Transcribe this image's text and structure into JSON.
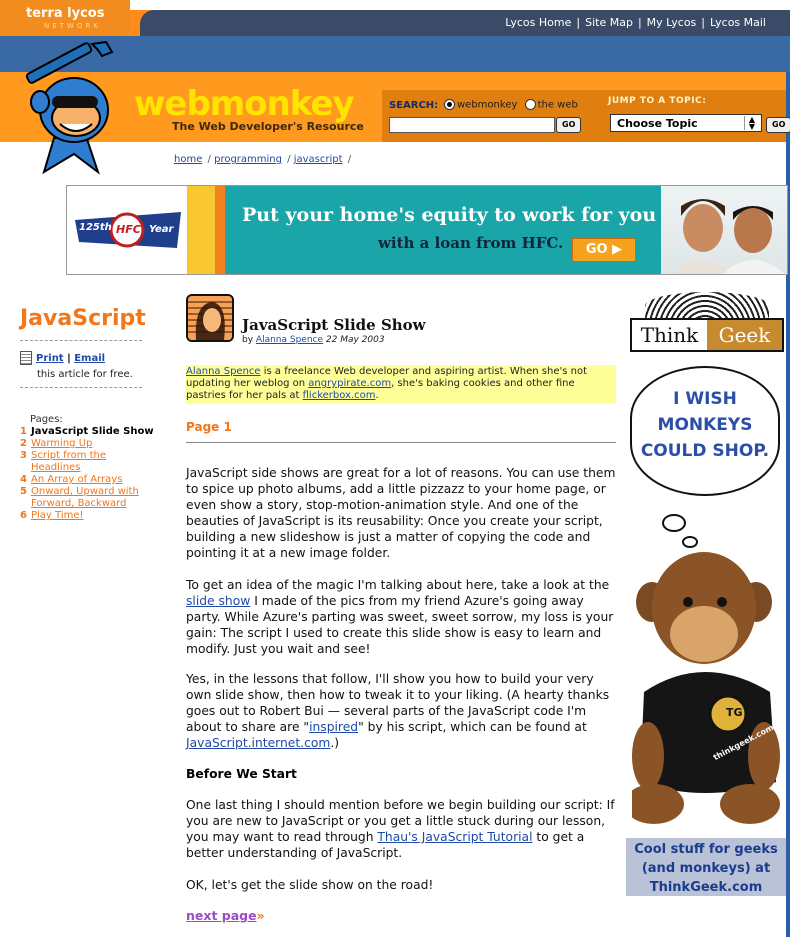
{
  "lycos_bar": {
    "brand": "terra lycos",
    "network": "NETWORK",
    "links": [
      "Lycos Home",
      "Site Map",
      "My Lycos",
      "Lycos Mail"
    ]
  },
  "header": {
    "title": "webmonkey",
    "subtitle": "The Web Developer's Resource",
    "search_label": "SEARCH:",
    "search_options": [
      "webmonkey",
      "the web"
    ],
    "search_selected": "webmonkey",
    "search_value": "",
    "go_label": "GO",
    "topic_label": "JUMP TO A TOPIC:",
    "topic_selected": "Choose Topic"
  },
  "breadcrumb": [
    "home",
    "programming",
    "javascript"
  ],
  "ad_banner": {
    "headline": "Put your home's equity to work for you",
    "subline": "with a loan from HFC.",
    "button": "GO",
    "badge_left": "125th",
    "badge_logo": "HFC",
    "badge_right": "Year"
  },
  "sidebar": {
    "section_title": "JavaScript",
    "print_label": "Print",
    "email_label": "Email",
    "free_text": "this article for free.",
    "pages_label": "Pages:",
    "pages": [
      {
        "num": "1",
        "label": "JavaScript Slide Show",
        "current": true
      },
      {
        "num": "2",
        "label": "Warming Up",
        "current": false
      },
      {
        "num": "3",
        "label": "Script from the Headlines",
        "current": false
      },
      {
        "num": "4",
        "label": "An Array of Arrays",
        "current": false
      },
      {
        "num": "5",
        "label": "Onward, Upward with Forward, Backward",
        "current": false
      },
      {
        "num": "6",
        "label": "Play Time!",
        "current": false
      }
    ]
  },
  "article": {
    "title": "JavaScript Slide Show",
    "by": "by",
    "author": "Alanna Spence",
    "date": "22 May 2003",
    "bio": {
      "author_link": "Alanna Spence",
      "text1": " is a freelance Web developer and aspiring artist. When she's not updating her weblog on ",
      "link1": "angrypirate.com",
      "text2": ", she's baking cookies and other fine pastries for her pals at ",
      "link2": "flickerbox.com",
      "text3": "."
    },
    "page_heading": "Page 1",
    "p1": "JavaScript side shows are great for a lot of reasons. You can use them to spice up photo albums, add a little pizzazz to your home page, or even show a story, stop-motion-animation style. And one of the beauties of JavaScript is its reusability: Once you create your script, building a new slideshow is just a matter of copying the code and pointing it at a new image folder.",
    "p2": {
      "a": "To get an idea of the magic I'm talking about here, take a look at the ",
      "link": "slide show",
      "b": " I made of the pics from my friend Azure's going away party. While Azure's parting was sweet, sweet sorrow, my loss is your gain: The script I used to create this slide show is easy to learn and modify. Just you wait and see!"
    },
    "p3": {
      "a": "Yes, in the lessons that follow, I'll show you how to build your very own slide show, then how to tweak it to your liking. (A hearty thanks goes out to Robert Bui — several parts of the JavaScript code I'm about to share are \"",
      "link1": "inspired",
      "b": "\" by his script, which can be found at ",
      "link2": "JavaScript.internet.com",
      "c": ".)"
    },
    "subheading": "Before We Start",
    "p4": {
      "a": "One last thing I should mention before we begin building our script: If you are new to JavaScript or you get a little stuck during our lesson, you may want to read through ",
      "link": "Thau's JavaScript Tutorial",
      "b": " to get a better understanding of JavaScript."
    },
    "p5": "OK, let's get the slide show on the road!",
    "next_label": "next page",
    "next_arrow": "»"
  },
  "right_ad": {
    "brand_left": "Think",
    "brand_right": "Geek",
    "bubble": "I WISH MONKEYS COULD SHOP.",
    "shirt_logo": "TG",
    "shirt_text": "thinkgeek.com",
    "bottom": "Cool stuff for geeks (and monkeys) at ThinkGeek.com"
  },
  "colors": {
    "accent_orange": "#f2761a",
    "header_orange": "#ff9a1f",
    "title_yellow": "#ffe400",
    "slate": "#3b4b67",
    "link_blue": "#1f4aa8"
  }
}
